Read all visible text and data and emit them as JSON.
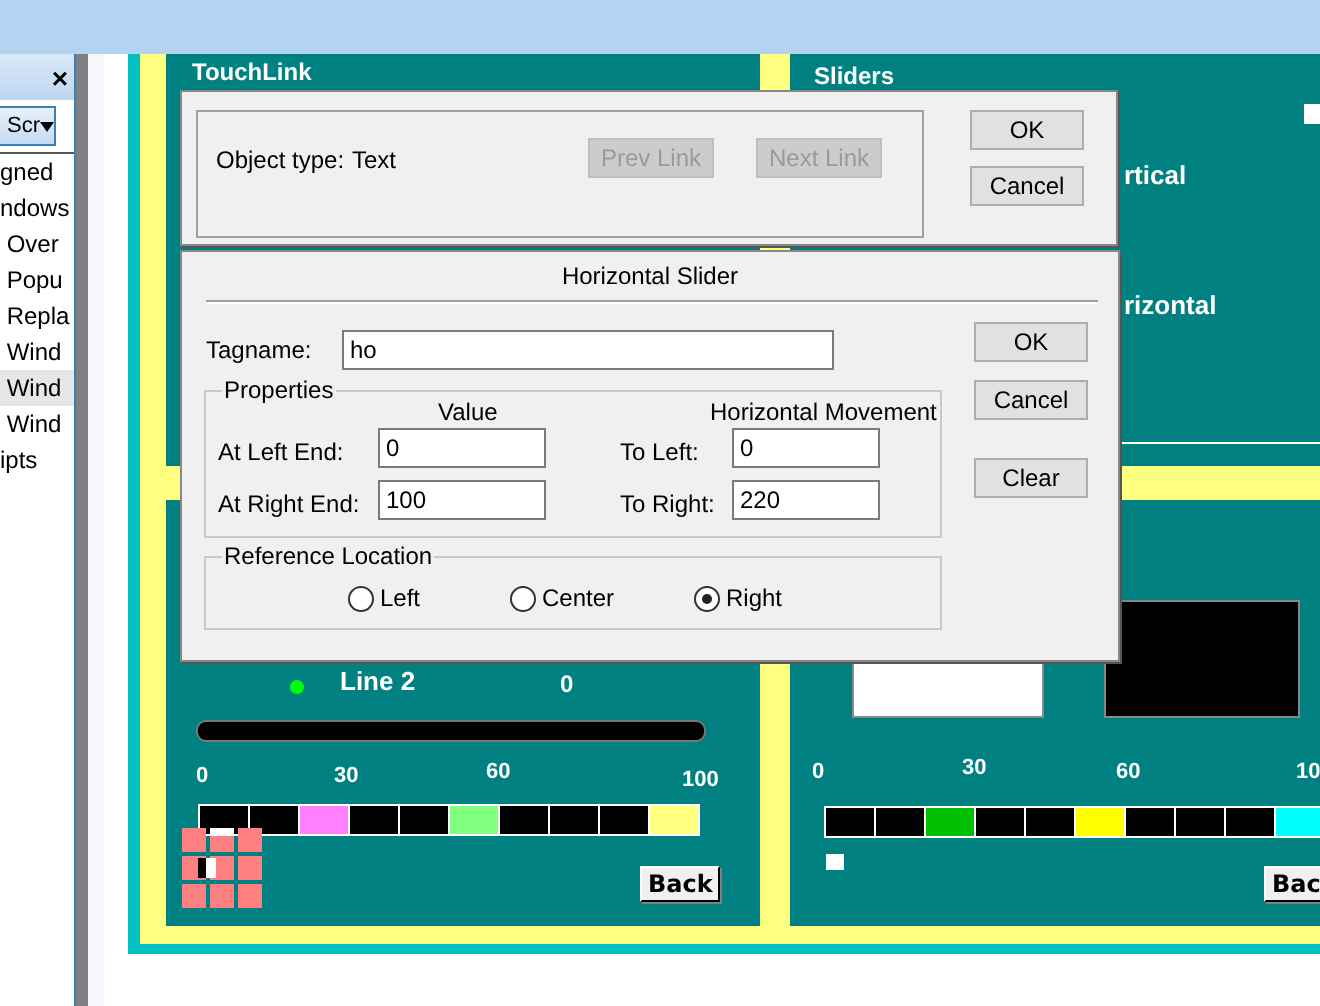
{
  "side_panel": {
    "close": "×",
    "dropdown": "Scr",
    "items": [
      {
        "label": "gned",
        "selected": false
      },
      {
        "label": "ndows",
        "selected": false
      },
      {
        "label": " Over",
        "selected": false
      },
      {
        "label": " Popu",
        "selected": false
      },
      {
        "label": " Repla",
        "selected": false
      },
      {
        "label": " Wind",
        "selected": false
      },
      {
        "label": " Wind",
        "selected": true
      },
      {
        "label": " Wind",
        "selected": false
      },
      {
        "label": "ipts",
        "selected": false
      }
    ]
  },
  "left_panel": {
    "title": "TouchLink",
    "line_label": "Line 2",
    "line_value": "0",
    "scale_labels": [
      "0",
      "30",
      "60",
      "100"
    ],
    "segments": [
      {
        "color": "#000000"
      },
      {
        "color": "#000000"
      },
      {
        "color": "#ff80ff"
      },
      {
        "color": "#000000"
      },
      {
        "color": "#000000"
      },
      {
        "color": "#80ff80"
      },
      {
        "color": "#000000"
      },
      {
        "color": "#000000"
      },
      {
        "color": "#000000"
      },
      {
        "color": "#ffff80"
      }
    ],
    "back_button": "Back"
  },
  "right_panel": {
    "title": "Sliders",
    "labels": [
      "rtical",
      "rizontal"
    ],
    "scale_labels": [
      "0",
      "30",
      "60",
      "10"
    ],
    "segments": [
      {
        "color": "#000000"
      },
      {
        "color": "#000000"
      },
      {
        "color": "#00c000"
      },
      {
        "color": "#000000"
      },
      {
        "color": "#000000"
      },
      {
        "color": "#ffff00"
      },
      {
        "color": "#000000"
      },
      {
        "color": "#000000"
      },
      {
        "color": "#000000"
      },
      {
        "color": "#00ffff"
      }
    ],
    "back_button": "Bac"
  },
  "touchlink_dialog": {
    "object_type_label": "Object type:",
    "object_type": "Text",
    "link_buttons": [
      {
        "label": "Prev Link",
        "disabled": true
      },
      {
        "label": "Next Link",
        "disabled": true
      }
    ],
    "buttons": [
      "OK",
      "Cancel"
    ]
  },
  "slider_dialog": {
    "title": "Horizontal Slider",
    "tagname_label": "Tagname:",
    "tagname": "ho",
    "properties": {
      "title": "Properties",
      "value_header": "Value",
      "movement_header": "Horizontal Movement",
      "rows": [
        {
          "label": "At Left End:",
          "value": "0",
          "move_label": "To Left:",
          "move": "0"
        },
        {
          "label": "At Right End:",
          "value": "100",
          "move_label": "To Right:",
          "move": "220"
        }
      ]
    },
    "reference": {
      "title": "Reference Location",
      "options": [
        {
          "label": "Left",
          "selected": false
        },
        {
          "label": "Center",
          "selected": false
        },
        {
          "label": "Right",
          "selected": true
        }
      ]
    },
    "buttons": [
      "OK",
      "Cancel",
      "Clear"
    ]
  }
}
